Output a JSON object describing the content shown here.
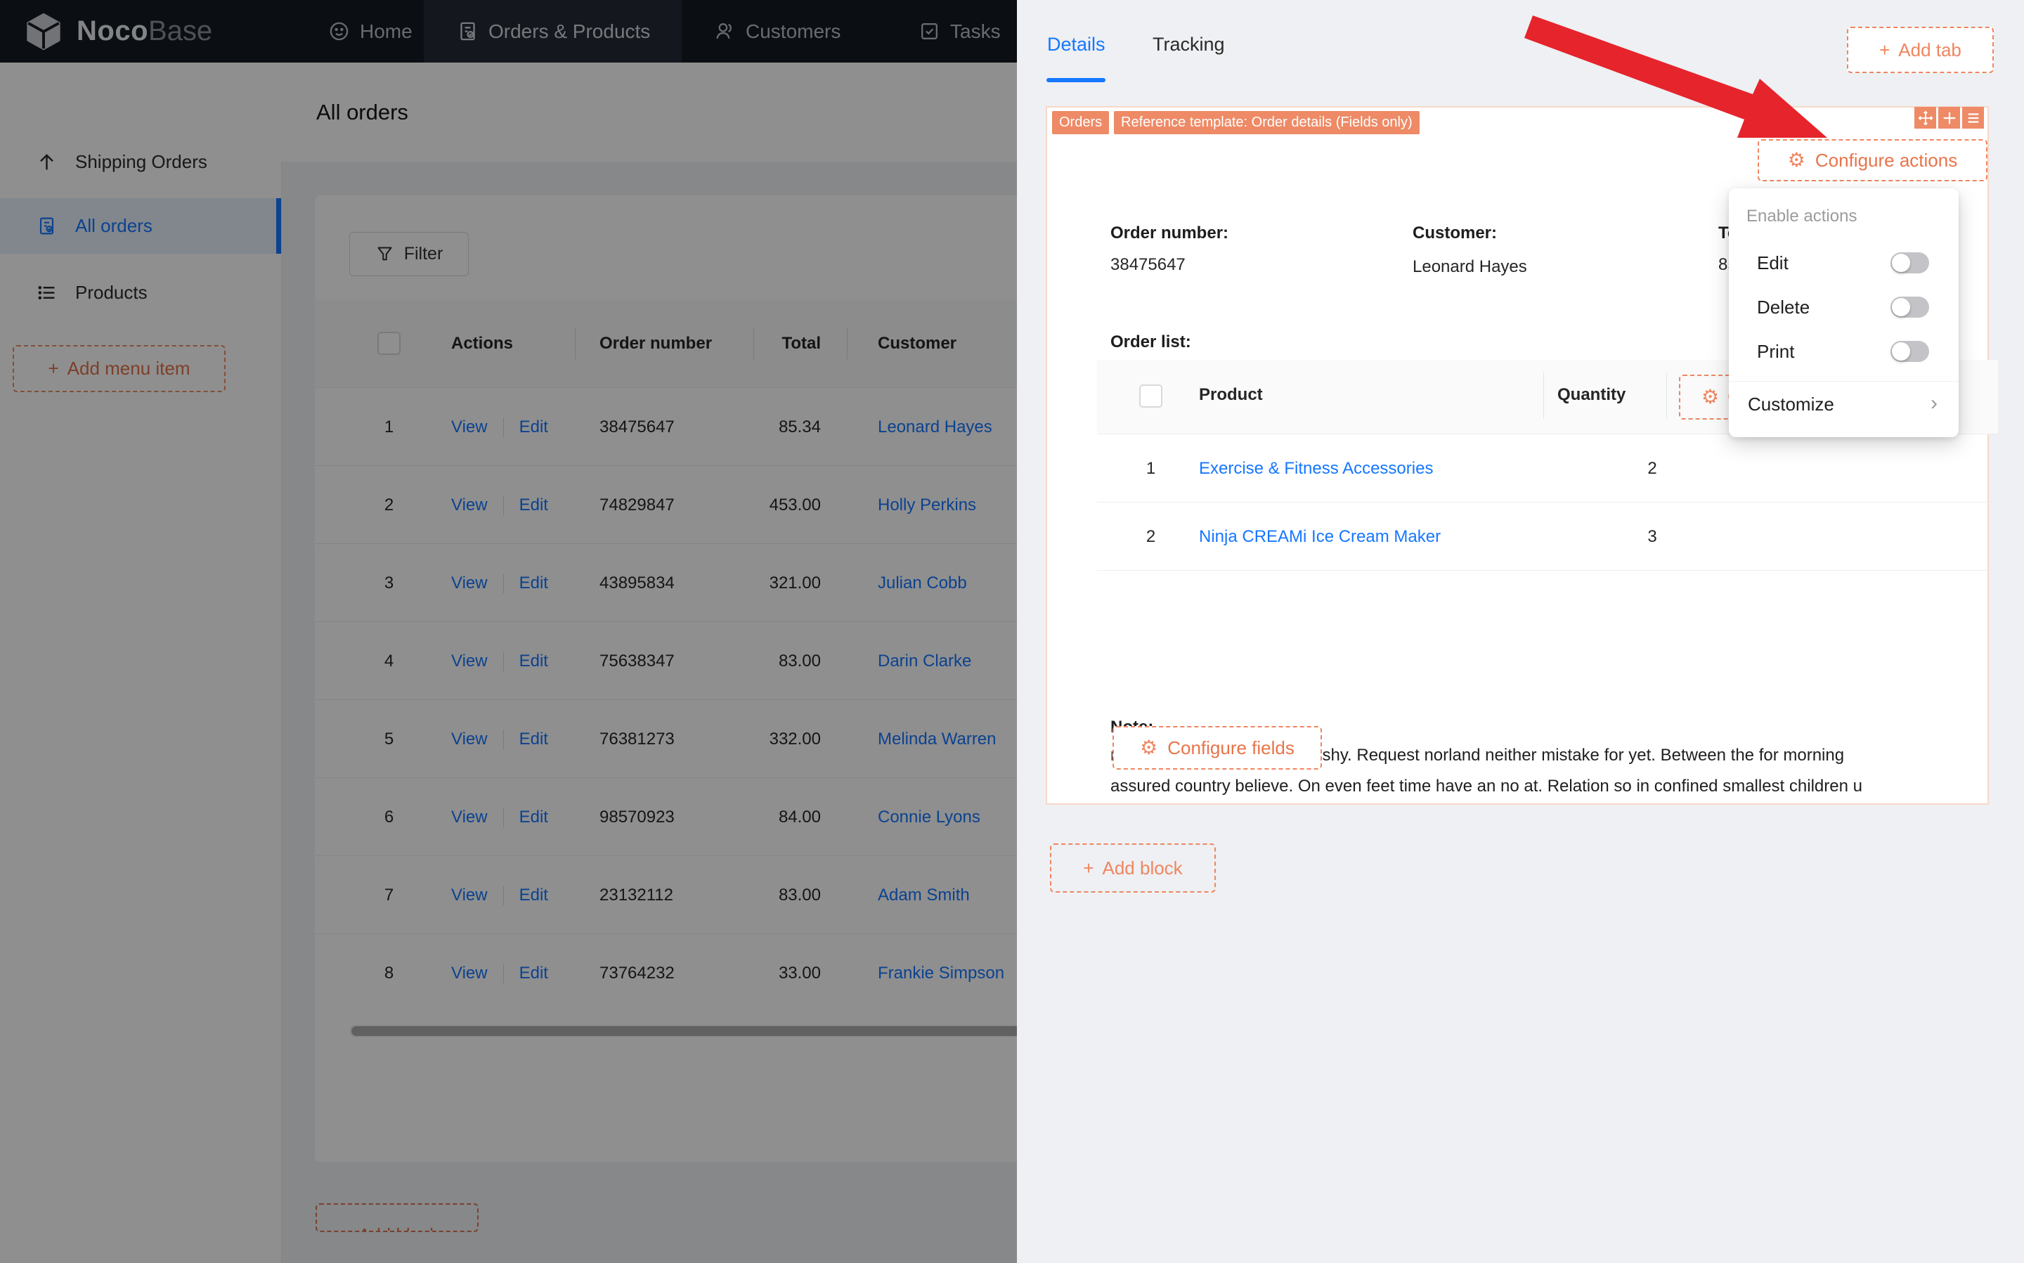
{
  "nav": {
    "logo_primary": "Noco",
    "logo_secondary": "Base",
    "items": [
      {
        "label": "Home"
      },
      {
        "label": "Orders & Products"
      },
      {
        "label": "Customers"
      },
      {
        "label": "Tasks"
      }
    ]
  },
  "sidebar": {
    "items": [
      {
        "label": "Shipping Orders"
      },
      {
        "label": "All orders"
      },
      {
        "label": "Products"
      }
    ],
    "add_menu_item_label": "Add menu item"
  },
  "page": {
    "title": "All orders",
    "filter_label": "Filter",
    "add_block_label": "+ Add block"
  },
  "orders_table": {
    "headers": {
      "actions": "Actions",
      "order_number": "Order number",
      "total": "Total",
      "customer": "Customer"
    },
    "action_labels": {
      "view": "View",
      "edit": "Edit"
    },
    "rows": [
      {
        "no": "1",
        "order_number": "38475647",
        "total": "85.34",
        "customer": "Leonard Hayes"
      },
      {
        "no": "2",
        "order_number": "74829847",
        "total": "453.00",
        "customer": "Holly Perkins"
      },
      {
        "no": "3",
        "order_number": "43895834",
        "total": "321.00",
        "customer": "Julian Cobb"
      },
      {
        "no": "4",
        "order_number": "75638347",
        "total": "83.00",
        "customer": "Darin Clarke"
      },
      {
        "no": "5",
        "order_number": "76381273",
        "total": "332.00",
        "customer": "Melinda Warren"
      },
      {
        "no": "6",
        "order_number": "98570923",
        "total": "84.00",
        "customer": "Connie Lyons"
      },
      {
        "no": "7",
        "order_number": "23132112",
        "total": "83.00",
        "customer": "Adam Smith"
      },
      {
        "no": "8",
        "order_number": "73764232",
        "total": "33.00",
        "customer": "Frankie Simpson"
      }
    ]
  },
  "drawer": {
    "tabs": [
      {
        "label": "Details"
      },
      {
        "label": "Tracking"
      }
    ],
    "add_tab_label": "Add tab",
    "block": {
      "badges": [
        "Orders",
        "Reference template: Order details (Fields only)"
      ],
      "configure_actions_label": "Configure actions",
      "fields": {
        "order_number_label": "Order number:",
        "order_number_value": "38475647",
        "customer_label": "Customer:",
        "customer_value": "Leonard Hayes",
        "total_label": "Total:",
        "total_value": "85.34"
      },
      "order_list_label": "Order list:",
      "order_list": {
        "product_header": "Product",
        "quantity_header": "Quantity",
        "configure_columns_label": "Configure columns",
        "rows": [
          {
            "no": "1",
            "product": "Exercise & Fitness Accessories",
            "quantity": "2"
          },
          {
            "no": "2",
            "product": "Ninja CREAMi Ice Cream Maker",
            "quantity": "3"
          }
        ]
      },
      "note_label": "Note:",
      "note_line1": "moreover man feelings own shy. Request norland neither mistake for yet. Between the for morning",
      "note_line2": "assured country believe. On even feet time have an no at. Relation so in confined smallest children u",
      "configure_fields_label": "Configure fields"
    },
    "add_block_label": "Add block",
    "actions_menu": {
      "header": "Enable actions",
      "toggles": [
        {
          "label": "Edit",
          "state": "off"
        },
        {
          "label": "Delete",
          "state": "off"
        },
        {
          "label": "Print",
          "state": "off"
        }
      ],
      "customize_label": "Customize"
    }
  },
  "colors": {
    "accent_orange_solid": "#ee8a66",
    "accent_orange_text": "#e8744a",
    "link_blue": "#1677ff",
    "nav_bg": "#151a21",
    "drawer_bg": "#eef0f3",
    "arrow_red": "#e5242c"
  }
}
